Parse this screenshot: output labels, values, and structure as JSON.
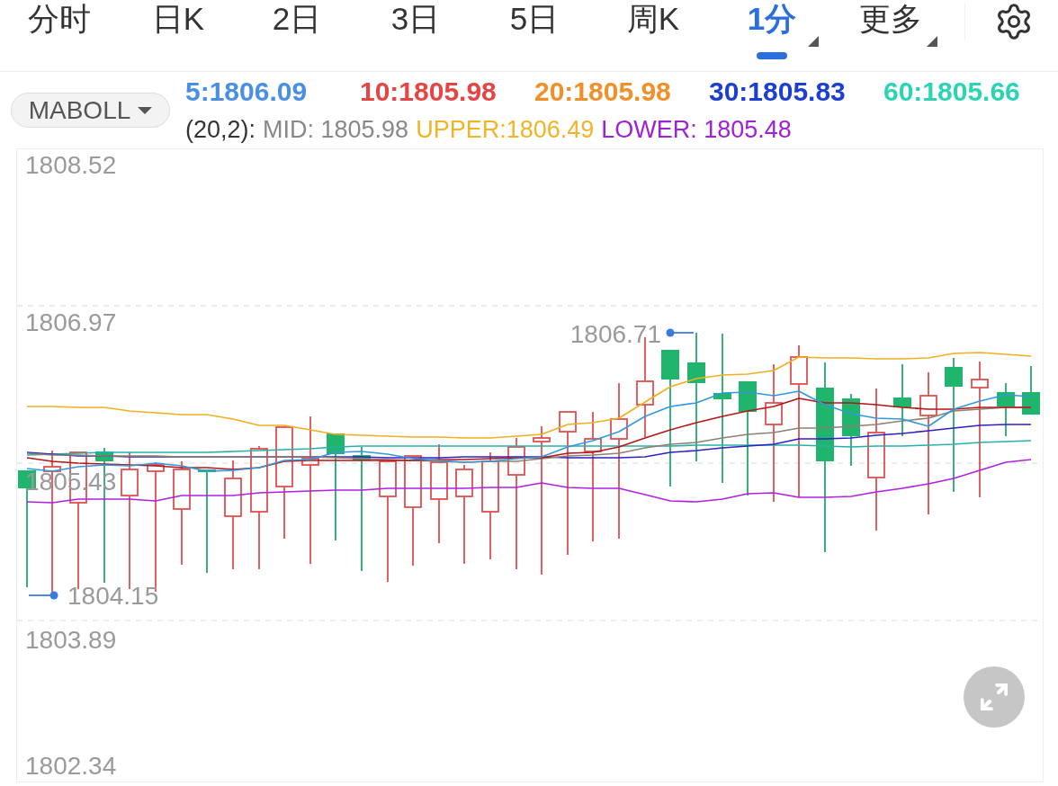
{
  "tabs": [
    {
      "label": "分时",
      "selected": false,
      "dropdown": false
    },
    {
      "label": "日K",
      "selected": false,
      "dropdown": false
    },
    {
      "label": "2日",
      "selected": false,
      "dropdown": false
    },
    {
      "label": "3日",
      "selected": false,
      "dropdown": false
    },
    {
      "label": "5日",
      "selected": false,
      "dropdown": false
    },
    {
      "label": "周K",
      "selected": false,
      "dropdown": false
    },
    {
      "label": "1分",
      "selected": true,
      "dropdown": true
    },
    {
      "label": "更多",
      "selected": false,
      "dropdown": true
    }
  ],
  "indicator_selector": {
    "label": "MABOLL"
  },
  "ma_legend": [
    {
      "label": "5:1806.09",
      "color": "#4a90e2"
    },
    {
      "label": "10:1805.98",
      "color": "#e64545"
    },
    {
      "label": "20:1805.98",
      "color": "#f0902a"
    },
    {
      "label": "30:1805.83",
      "color": "#1c3fd1"
    },
    {
      "label": "60:1805.66",
      "color": "#2dd4b4"
    }
  ],
  "boll_legend": [
    {
      "label": "(20,2):",
      "color": "#333333"
    },
    {
      "label": "MID: 1805.98",
      "color": "#888888"
    },
    {
      "label": "UPPER:1806.49",
      "color": "#f0b428"
    },
    {
      "label": "LOWER: 1805.48",
      "color": "#a020d8"
    }
  ],
  "chart": {
    "y_axis_labels": [
      "1808.52",
      "1806.97",
      "1805.43",
      "1803.89",
      "1802.34"
    ],
    "high_label": "1806.71",
    "low_label": "1804.15"
  }
}
